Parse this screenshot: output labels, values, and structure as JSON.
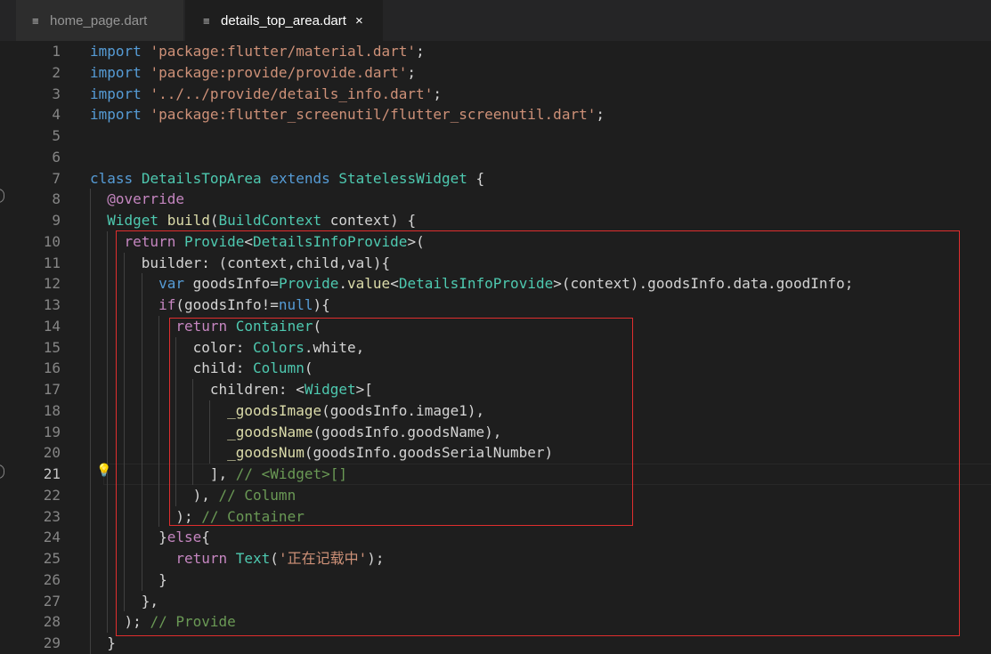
{
  "tabs": [
    {
      "label": "home_page.dart",
      "icon": "file-lines-icon",
      "active": false
    },
    {
      "label": "details_top_area.dart",
      "icon": "file-lines-icon",
      "active": true,
      "close": "×"
    }
  ],
  "editor": {
    "current_line": 21,
    "lines": [
      {
        "n": "1",
        "tokens": [
          [
            "k",
            "import"
          ],
          [
            "p",
            " "
          ],
          [
            "s",
            "'package:flutter/material.dart'"
          ],
          [
            "p",
            ";"
          ]
        ]
      },
      {
        "n": "2",
        "tokens": [
          [
            "k",
            "import"
          ],
          [
            "p",
            " "
          ],
          [
            "s",
            "'package:provide/provide.dart'"
          ],
          [
            "p",
            ";"
          ]
        ]
      },
      {
        "n": "3",
        "tokens": [
          [
            "k",
            "import"
          ],
          [
            "p",
            " "
          ],
          [
            "s",
            "'../../provide/details_info.dart'"
          ],
          [
            "p",
            ";"
          ]
        ]
      },
      {
        "n": "4",
        "tokens": [
          [
            "k",
            "import"
          ],
          [
            "p",
            " "
          ],
          [
            "s",
            "'package:flutter_screenutil/flutter_screenutil.dart'"
          ],
          [
            "p",
            ";"
          ]
        ]
      },
      {
        "n": "5",
        "tokens": []
      },
      {
        "n": "6",
        "tokens": []
      },
      {
        "n": "7",
        "tokens": [
          [
            "k",
            "class"
          ],
          [
            "p",
            " "
          ],
          [
            "t",
            "DetailsTopArea"
          ],
          [
            "p",
            " "
          ],
          [
            "k",
            "extends"
          ],
          [
            "p",
            " "
          ],
          [
            "t",
            "StatelessWidget"
          ],
          [
            "p",
            " {"
          ]
        ]
      },
      {
        "n": "8",
        "tokens": [
          [
            "p",
            "  "
          ],
          [
            "c",
            "@override"
          ]
        ]
      },
      {
        "n": "9",
        "tokens": [
          [
            "p",
            "  "
          ],
          [
            "t",
            "Widget"
          ],
          [
            "p",
            " "
          ],
          [
            "f",
            "build"
          ],
          [
            "p",
            "("
          ],
          [
            "t",
            "BuildContext"
          ],
          [
            "p",
            " context) {"
          ]
        ]
      },
      {
        "n": "10",
        "tokens": [
          [
            "p",
            "    "
          ],
          [
            "c",
            "return"
          ],
          [
            "p",
            " "
          ],
          [
            "t",
            "Provide"
          ],
          [
            "p",
            "<"
          ],
          [
            "t",
            "DetailsInfoProvide"
          ],
          [
            "p",
            ">("
          ]
        ]
      },
      {
        "n": "11",
        "tokens": [
          [
            "p",
            "      builder: (context,child,val){"
          ]
        ]
      },
      {
        "n": "12",
        "tokens": [
          [
            "p",
            "        "
          ],
          [
            "k",
            "var"
          ],
          [
            "p",
            " goodsInfo="
          ],
          [
            "t",
            "Provide"
          ],
          [
            "p",
            "."
          ],
          [
            "f",
            "value"
          ],
          [
            "p",
            "<"
          ],
          [
            "t",
            "DetailsInfoProvide"
          ],
          [
            "p",
            ">(context).goodsInfo.data.goodInfo;"
          ]
        ]
      },
      {
        "n": "13",
        "tokens": [
          [
            "p",
            "        "
          ],
          [
            "c",
            "if"
          ],
          [
            "p",
            "(goodsInfo!="
          ],
          [
            "k",
            "null"
          ],
          [
            "p",
            "){"
          ]
        ]
      },
      {
        "n": "14",
        "tokens": [
          [
            "p",
            "          "
          ],
          [
            "c",
            "return"
          ],
          [
            "p",
            " "
          ],
          [
            "t",
            "Container"
          ],
          [
            "p",
            "("
          ]
        ]
      },
      {
        "n": "15",
        "tokens": [
          [
            "p",
            "            color: "
          ],
          [
            "t",
            "Colors"
          ],
          [
            "p",
            ".white,"
          ]
        ]
      },
      {
        "n": "16",
        "tokens": [
          [
            "p",
            "            child: "
          ],
          [
            "t",
            "Column"
          ],
          [
            "p",
            "("
          ]
        ]
      },
      {
        "n": "17",
        "tokens": [
          [
            "p",
            "              children: <"
          ],
          [
            "t",
            "Widget"
          ],
          [
            "p",
            ">["
          ]
        ]
      },
      {
        "n": "18",
        "tokens": [
          [
            "p",
            "                "
          ],
          [
            "f",
            "_goodsImage"
          ],
          [
            "p",
            "(goodsInfo.image1),"
          ]
        ]
      },
      {
        "n": "19",
        "tokens": [
          [
            "p",
            "                "
          ],
          [
            "f",
            "_goodsName"
          ],
          [
            "p",
            "(goodsInfo.goodsName),"
          ]
        ]
      },
      {
        "n": "20",
        "tokens": [
          [
            "p",
            "                "
          ],
          [
            "f",
            "_goodsNum"
          ],
          [
            "p",
            "(goodsInfo.goodsSerialNumber)"
          ]
        ]
      },
      {
        "n": "21",
        "tokens": [
          [
            "p",
            "              ], "
          ],
          [
            "cm",
            "// <Widget>[]"
          ]
        ]
      },
      {
        "n": "22",
        "tokens": [
          [
            "p",
            "            ), "
          ],
          [
            "cm",
            "// Column"
          ]
        ]
      },
      {
        "n": "23",
        "tokens": [
          [
            "p",
            "          ); "
          ],
          [
            "cm",
            "// Container"
          ]
        ]
      },
      {
        "n": "24",
        "tokens": [
          [
            "p",
            "        }"
          ],
          [
            "c",
            "else"
          ],
          [
            "p",
            "{"
          ]
        ]
      },
      {
        "n": "25",
        "tokens": [
          [
            "p",
            "          "
          ],
          [
            "c",
            "return"
          ],
          [
            "p",
            " "
          ],
          [
            "t",
            "Text"
          ],
          [
            "p",
            "("
          ],
          [
            "s",
            "'正在记载中'"
          ],
          [
            "p",
            ");"
          ]
        ]
      },
      {
        "n": "26",
        "tokens": [
          [
            "p",
            "        }"
          ]
        ]
      },
      {
        "n": "27",
        "tokens": [
          [
            "p",
            "      },"
          ]
        ]
      },
      {
        "n": "28",
        "tokens": [
          [
            "p",
            "    ); "
          ],
          [
            "cm",
            "// Provide"
          ]
        ]
      },
      {
        "n": "29",
        "tokens": [
          [
            "p",
            "  }"
          ]
        ]
      }
    ]
  },
  "colors": {
    "keyword": "#569cd6",
    "control": "#c586c0",
    "string": "#ce9178",
    "type": "#4ec9b0",
    "function": "#dcdcaa",
    "comment": "#6a9955",
    "text": "#d4d4d4",
    "highlight_box": "#e02e2e"
  }
}
